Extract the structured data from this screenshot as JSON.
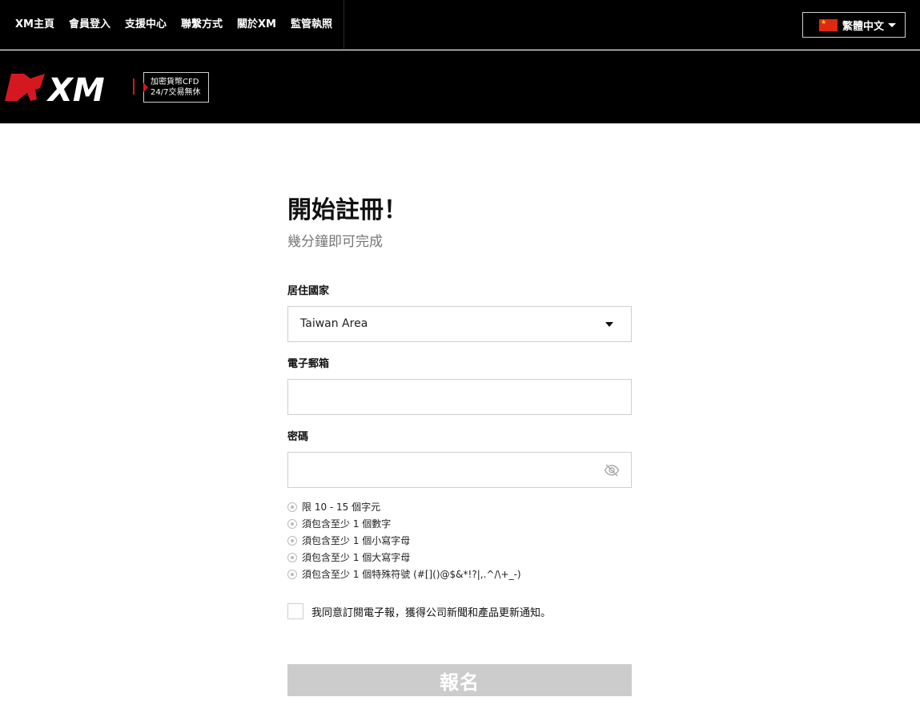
{
  "nav": {
    "items": [
      "XM主頁",
      "會員登入",
      "支援中心",
      "聯繫方式",
      "關於XM",
      "監管執照"
    ]
  },
  "language": {
    "label": "繁體中文",
    "flag": "china-flag-icon"
  },
  "logo": {
    "text": "XM"
  },
  "promo": {
    "line1": "加密貨幣CFD",
    "line2": "24/7交易無休"
  },
  "form": {
    "title": "開始註冊！",
    "subtitle": "幾分鐘即可完成",
    "country_label": "居住國家",
    "country_value": "Taiwan Area",
    "email_label": "電子郵箱",
    "email_value": "",
    "password_label": "密碼",
    "password_value": "",
    "rules": [
      "限 10 - 15 個字元",
      "須包含至少 1 個數字",
      "須包含至少 1 個小寫字母",
      "須包含至少 1 個大寫字母",
      "須包含至少 1 個特殊符號 (#[]()@$&*!?|,.^/\\+_-)"
    ],
    "consent_text": "我同意訂閱電子報，獲得公司新聞和產品更新通知。",
    "consent_checked": false,
    "submit_label": "報名"
  },
  "colors": {
    "brand_red": "#d51820",
    "topbar_bg": "#000000",
    "disabled_button": "#cccccc"
  }
}
